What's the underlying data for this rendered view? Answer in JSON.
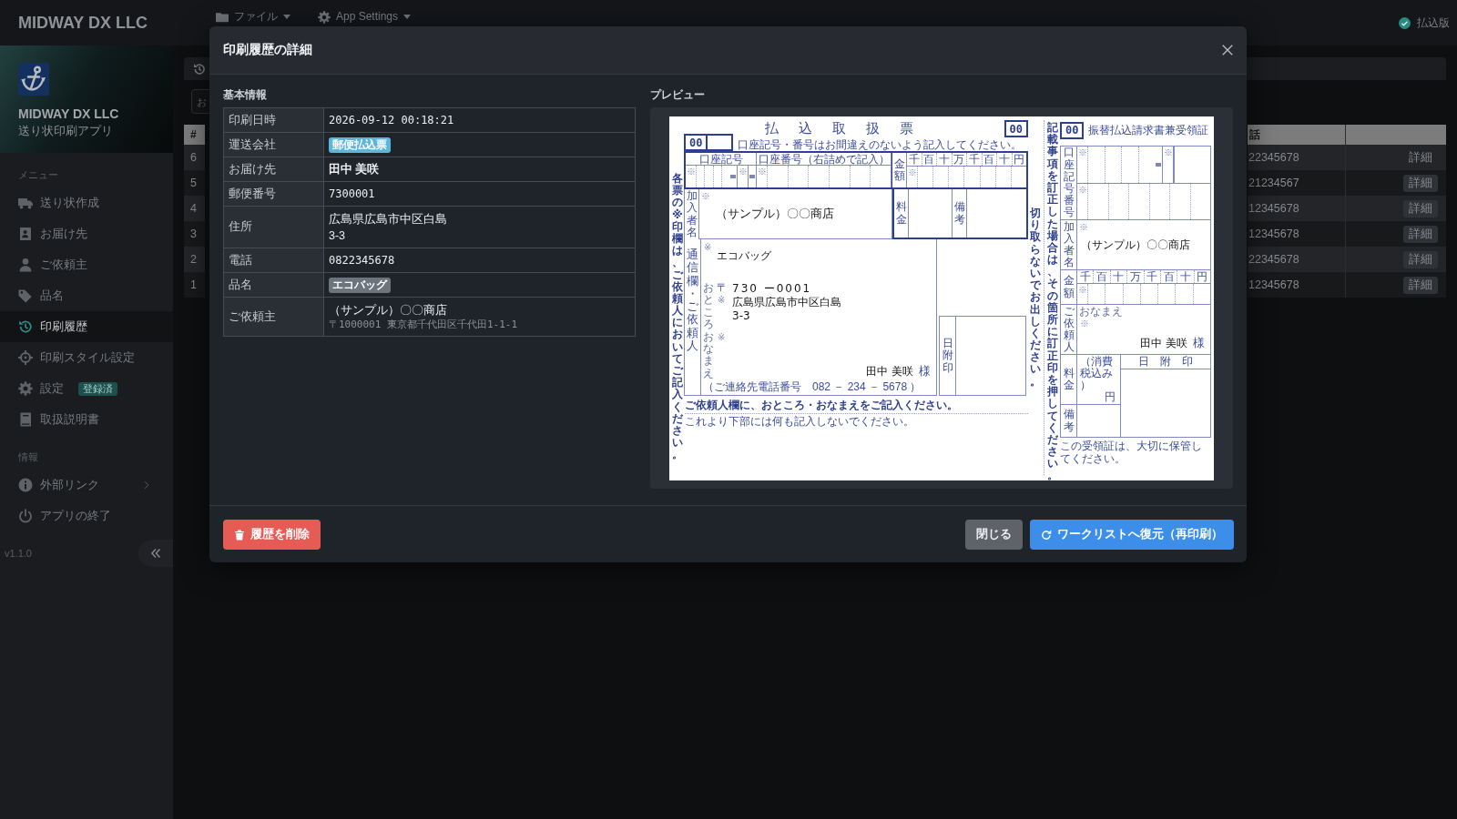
{
  "topbar": {
    "brand": "MIDWAY DX LLC",
    "menus": [
      {
        "label": "ファイル"
      },
      {
        "label": "App Settings"
      }
    ],
    "edition": "払込版"
  },
  "sidebar": {
    "company": "MIDWAY DX LLC",
    "app_name": "送り状印刷アプリ",
    "sections": [
      {
        "heading": "メニュー",
        "items": [
          {
            "label": "送り状作成",
            "selected": false,
            "expandable": false
          },
          {
            "label": "お届け先",
            "selected": false,
            "expandable": false
          },
          {
            "label": "ご依頼主",
            "selected": false,
            "expandable": false
          },
          {
            "label": "品名",
            "selected": false,
            "expandable": false
          },
          {
            "label": "印刷履歴",
            "selected": true,
            "expandable": false
          },
          {
            "label": "印刷スタイル設定",
            "selected": false,
            "expandable": false
          },
          {
            "label": "設定",
            "selected": false,
            "expandable": false,
            "badge": "登録済"
          },
          {
            "label": "取扱説明書",
            "selected": false,
            "expandable": false
          }
        ]
      },
      {
        "heading": "情報",
        "items": [
          {
            "label": "外部リンク",
            "selected": false,
            "expandable": true
          },
          {
            "label": "アプリの終了",
            "selected": false,
            "expandable": false
          }
        ]
      }
    ],
    "version": "v1.1.0"
  },
  "history": {
    "search": {
      "placeholder": "お"
    },
    "table": {
      "columns": [
        {
          "label": "#"
        },
        {
          "label": "話"
        }
      ],
      "rows": [
        {
          "cells": [
            "6",
            "22345678"
          ],
          "action": {
            "label": "詳細",
            "kind": "plain"
          }
        },
        {
          "cells": [
            "5",
            "21234567"
          ],
          "action": {
            "label": "詳細",
            "kind": "button"
          }
        },
        {
          "cells": [
            "4",
            "12345678"
          ],
          "action": {
            "label": "詳細",
            "kind": "button"
          }
        },
        {
          "cells": [
            "3",
            "12345678"
          ],
          "action": {
            "label": "詳細",
            "kind": "button"
          }
        },
        {
          "cells": [
            "2",
            "22345678"
          ],
          "action": {
            "label": "詳細",
            "kind": "button"
          }
        },
        {
          "cells": [
            "1",
            "12345678"
          ],
          "action": {
            "label": "詳細",
            "kind": "button"
          }
        }
      ]
    }
  },
  "modal": {
    "title": "印刷履歴の詳細",
    "info": {
      "heading": "基本情報",
      "fields": [
        {
          "label": "印刷日時",
          "kind": "mono",
          "value": "2026-09-12 00:18:21"
        },
        {
          "label": "運送会社",
          "kind": "badge",
          "value": "郵便払込票",
          "color": "#5bb6d9"
        },
        {
          "label": "お届け先",
          "kind": "bold",
          "value": "田中 美咲"
        },
        {
          "label": "郵便番号",
          "kind": "mono",
          "value": "7300001"
        },
        {
          "label": "住所",
          "kind": "lines",
          "lines": [
            "広島県広島市中区白島",
            "3-3"
          ]
        },
        {
          "label": "電話",
          "kind": "mono",
          "value": "0822345678"
        },
        {
          "label": "品名",
          "kind": "badge",
          "value": "エコバッグ",
          "color": "#6c757d"
        },
        {
          "label": "ご依頼主",
          "kind": "sender",
          "value": "（サンプル）〇〇商店",
          "note": "〒1000001 東京都千代田区千代田1-1-1"
        }
      ]
    },
    "preview": {
      "heading": "プレビュー",
      "slip": {
        "side_note": "各票の※印欄は、ご依頼人においてご記入ください。",
        "left": {
          "codes": [
            "00",
            "00"
          ],
          "title": "払込取扱票",
          "instruction": "口座記号・番号はお間違えのないよう記入してください。",
          "account": {
            "symbol_label": "口座記号",
            "number_label": "口座番号（右詰めで記入）",
            "marks": [
              "※",
              "※",
              "※"
            ]
          },
          "amount": {
            "label": "金額",
            "digits": [
              "千",
              "百",
              "十",
              "万",
              "千",
              "百",
              "十",
              "円"
            ],
            "mark": "※"
          },
          "payee": {
            "label": "加入者名",
            "mark": "※",
            "value": "（サンプル）〇〇商店"
          },
          "fee_label": "料金",
          "remarks_label": "備考",
          "message": {
            "label": "通信欄・ご依頼人",
            "mark": "※",
            "value": "エコバッグ"
          },
          "address": {
            "label": "おところ",
            "postal_mark": "〒",
            "mark": "※",
            "postal_code": "730 ー0001",
            "lines": [
              "広島県広島市中区白島",
              "3-3"
            ]
          },
          "name": {
            "label": "おなまえ",
            "mark": "※",
            "value": "田中 美咲",
            "honorific": "様"
          },
          "phone": "（ご連絡先電話番号　082 － 234 － 5678 ）",
          "notes": [
            "ご依頼人欄に、おところ・おなまえをご記入ください。",
            "これより下部には何も記入しないでください。"
          ],
          "stamp_label": "日附印"
        },
        "cut_note": "切り取らないでお出しください。",
        "correction_note": "記載事項を訂正した場合は、その箇所に訂正印を押してください。",
        "right": {
          "code": "00",
          "title": "振替払込請求書兼受領証",
          "account": {
            "label": "口座記号番号",
            "marks": [
              "※",
              "※",
              "※"
            ]
          },
          "payee": {
            "label": "加入者名",
            "mark": "※",
            "value": "（サンプル）〇〇商店"
          },
          "amount": {
            "label": "金額",
            "digits": [
              "千",
              "百",
              "十",
              "万",
              "千",
              "百",
              "十",
              "円"
            ],
            "mark": "※"
          },
          "sender": {
            "label": "ご依頼人",
            "name_label": "おなまえ",
            "mark": "※",
            "value": "田中 美咲",
            "honorific": "様"
          },
          "fee": {
            "label": "料金",
            "tax_note": "（消費税込み）",
            "unit": "円"
          },
          "stamp_label": "日附印",
          "remarks_label": "備考",
          "note": "この受領証は、大切に保管してください。"
        }
      }
    },
    "buttons": [
      {
        "label": "履歴を削除",
        "kind": "danger"
      },
      {
        "label": "閉じる",
        "kind": "secondary"
      },
      {
        "label": "ワークリストへ復元（再印刷）",
        "kind": "primary"
      }
    ]
  }
}
